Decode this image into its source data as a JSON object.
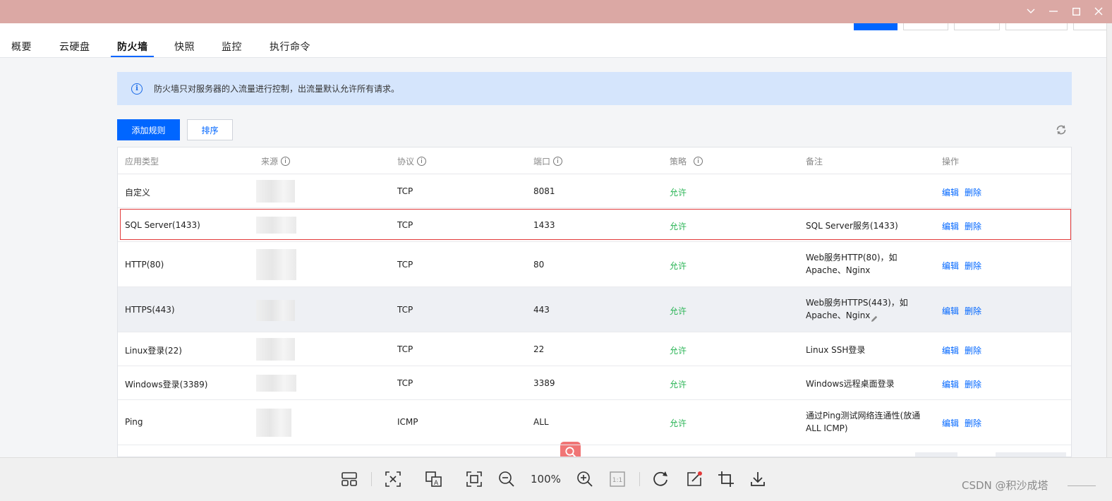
{
  "tabs": [
    {
      "label": "概要"
    },
    {
      "label": "云硬盘"
    },
    {
      "label": "防火墙"
    },
    {
      "label": "快照"
    },
    {
      "label": "监控"
    },
    {
      "label": "执行命令"
    }
  ],
  "active_tab": "防火墙",
  "banner": {
    "text": "防火墙只对服务器的入流量进行控制，出流量默认允许所有请求。"
  },
  "toolbar": {
    "add_label": "添加规则",
    "sort_label": "排序"
  },
  "table": {
    "headers": [
      "应用类型",
      "来源",
      "协议",
      "端口",
      "策略",
      "备注",
      "操作"
    ],
    "header_help": [
      false,
      true,
      true,
      true,
      true,
      false,
      false
    ],
    "rows": [
      {
        "type": "自定义",
        "protocol": "TCP",
        "port": "8081",
        "policy": "允许",
        "note1": "",
        "note2": "",
        "edit": "编辑",
        "delete": "删除"
      },
      {
        "type": "SQL Server(1433)",
        "protocol": "TCP",
        "port": "1433",
        "policy": "允许",
        "note1": "SQL Server服务(1433)",
        "note2": "",
        "edit": "编辑",
        "delete": "删除"
      },
      {
        "type": "HTTP(80)",
        "protocol": "TCP",
        "port": "80",
        "policy": "允许",
        "note1": "Web服务HTTP(80)，如",
        "note2": "Apache、Nginx",
        "edit": "编辑",
        "delete": "删除"
      },
      {
        "type": "HTTPS(443)",
        "protocol": "TCP",
        "port": "443",
        "policy": "允许",
        "note1": "Web服务HTTPS(443)，如",
        "note2": "Apache、Nginx",
        "edit": "编辑",
        "delete": "删除"
      },
      {
        "type": "Linux登录(22)",
        "protocol": "TCP",
        "port": "22",
        "policy": "允许",
        "note1": "Linux SSH登录",
        "note2": "",
        "edit": "编辑",
        "delete": "删除"
      },
      {
        "type": "Windows登录(3389)",
        "protocol": "TCP",
        "port": "3389",
        "policy": "允许",
        "note1": "Windows远程桌面登录",
        "note2": "",
        "edit": "编辑",
        "delete": "删除"
      },
      {
        "type": "Ping",
        "protocol": "ICMP",
        "port": "ALL",
        "policy": "允许",
        "note1": "通过Ping测试网络连通性(放通",
        "note2": "ALL ICMP)",
        "edit": "编辑",
        "delete": "删除"
      }
    ]
  },
  "viewer": {
    "zoom": "100%",
    "ratio_label": "1:1"
  },
  "watermark": "CSDN @积沙成塔",
  "colors": {
    "accent": "#0066ff",
    "allow": "#29b455",
    "titlebar": "#dba8a4",
    "banner": "#d5e5fc",
    "highlight": "#e23a3a"
  },
  "icons": [
    "info-icon",
    "help-icon",
    "refresh-icon",
    "search-icon",
    "edit-icon",
    "minimize-icon",
    "maximize-icon",
    "close-icon",
    "chevron-down-icon"
  ]
}
